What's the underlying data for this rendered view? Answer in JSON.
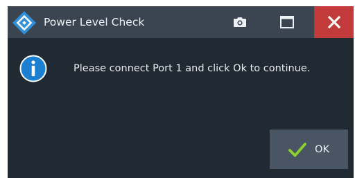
{
  "window": {
    "title": "Power Level Check",
    "logo_icon": "rohde-schwarz-logo-icon",
    "buttons": {
      "camera_icon": "camera-icon",
      "maximize_icon": "maximize-icon",
      "close_icon": "close-icon"
    }
  },
  "dialog": {
    "icon": "info-icon",
    "message": "Please connect Port 1 and click Ok to continue.",
    "ok_label": "OK",
    "ok_icon": "checkmark-icon"
  },
  "colors": {
    "titlebar": "#3b4552",
    "body": "#212933",
    "close_button": "#c23a3a",
    "info_icon": "#1d7fd0",
    "checkmark": "#8bd22e",
    "ok_button": "#4a5563"
  }
}
